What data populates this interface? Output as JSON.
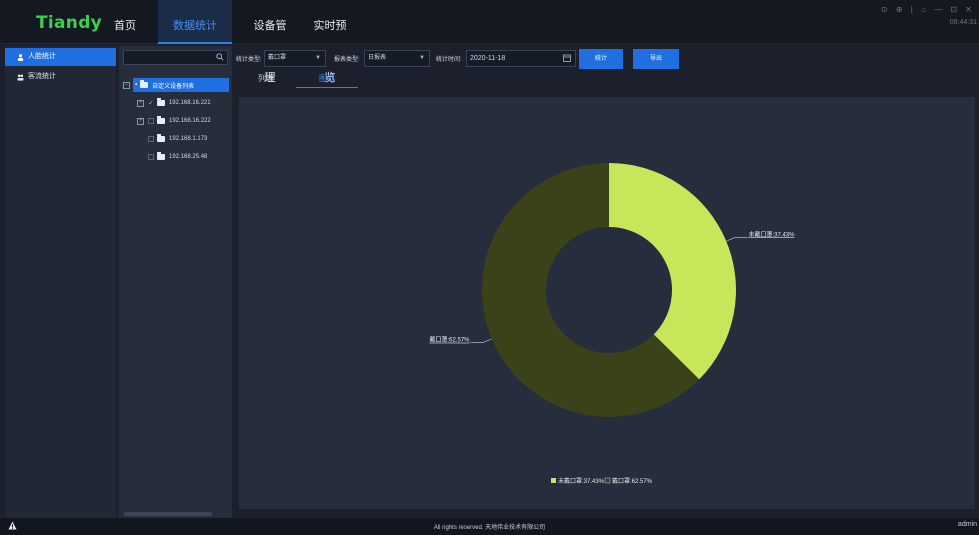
{
  "app": {
    "logo": "Tiandy"
  },
  "nav": [
    "首页",
    "数据统计",
    "设备管理",
    "实时预览"
  ],
  "window": {
    "controls": "⊙ ⊕ | ⌂ — ⊡ ✕",
    "time": "08:44:31"
  },
  "sidebar": {
    "items": [
      {
        "label": "人脸统计",
        "active": true
      },
      {
        "label": "客流统计",
        "active": false
      }
    ]
  },
  "tree": {
    "search_placeholder": "",
    "root": "自定义设备列表",
    "nodes": [
      "192.168.16.221",
      "192.168.16.222",
      "192.168.1.173",
      "192.168.25.48"
    ]
  },
  "toolbar": {
    "stat_type_label": "统计类型:",
    "stat_type_value": "戴口罩",
    "report_type_label": "报表类型:",
    "report_type_value": "日报表",
    "time_label": "统计时间:",
    "time_value": "2020-11-18",
    "stat_button": "统计",
    "export_button": "导出"
  },
  "tabs": [
    "列表",
    "图形"
  ],
  "chart_data": {
    "type": "pie",
    "donut": true,
    "categories": [
      "未戴口罩",
      "戴口罩"
    ],
    "values": [
      37.43,
      62.57
    ],
    "unit": "%",
    "slice_labels": [
      "未戴口罩:37.43%",
      "戴口罩:62.57%"
    ],
    "colors": [
      "#c8e65a",
      "#3b4119"
    ],
    "legend": [
      "未戴口罩:37.43%",
      "戴口罩:62.57%"
    ],
    "legend_placement": "bottom-center"
  },
  "footer": {
    "text": "All rights reserved. 天地伟业技术有限公司",
    "user": "admin"
  }
}
